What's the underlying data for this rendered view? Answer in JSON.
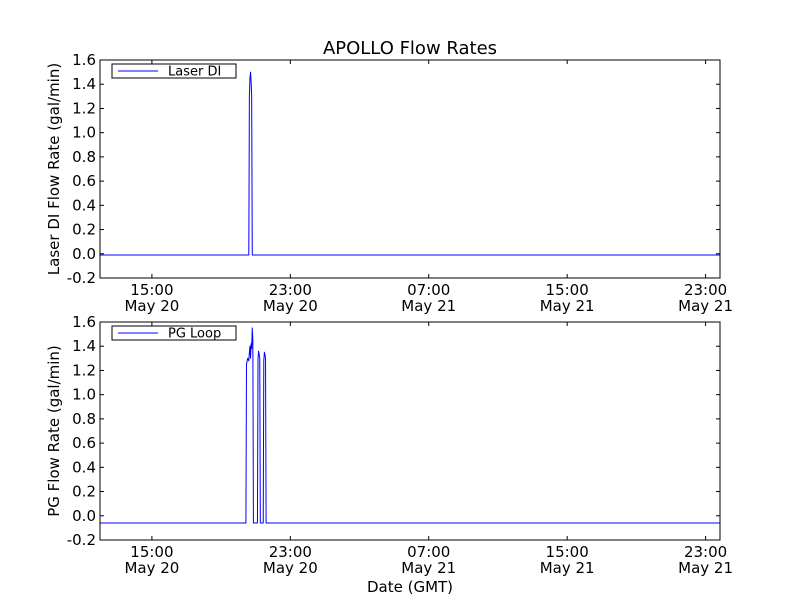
{
  "figure": {
    "title": "APOLLO Flow Rates",
    "xlabel": "Date (GMT)"
  },
  "chart_data": [
    {
      "type": "line",
      "ylabel": "Laser DI Flow Rate (gal/min)",
      "ylim": [
        -0.2,
        1.6
      ],
      "yticks": [
        -0.2,
        0.0,
        0.2,
        0.4,
        0.6,
        0.8,
        1.0,
        1.2,
        1.4,
        1.6
      ],
      "ytick_labels": [
        "-0.2",
        "0.0",
        "0.2",
        "0.4",
        "0.6",
        "0.8",
        "1.0",
        "1.2",
        "1.4",
        "1.6"
      ],
      "xlim": [
        "May 20 12:00",
        "May 21 23:50"
      ],
      "xticks": [
        {
          "time": "15:00",
          "date": "May 20"
        },
        {
          "time": "23:00",
          "date": "May 20"
        },
        {
          "time": "07:00",
          "date": "May 21"
        },
        {
          "time": "15:00",
          "date": "May 21"
        },
        {
          "time": "23:00",
          "date": "May 21"
        }
      ],
      "grid": false,
      "legend_loc": "upper-left",
      "series": [
        {
          "name": "Laser DI",
          "color": "#0000ff",
          "x": [
            "May 20 12:00",
            "May 20 20:30",
            "May 20 20:36",
            "May 20 20:38",
            "May 20 20:40",
            "May 20 20:42",
            "May 20 20:44",
            "May 20 20:46",
            "May 20 20:48",
            "May 20 20:54",
            "May 21 23:50"
          ],
          "y": [
            -0.01,
            -0.01,
            -0.01,
            1.3,
            1.45,
            1.5,
            1.42,
            1.3,
            -0.01,
            -0.01,
            -0.01
          ]
        }
      ]
    },
    {
      "type": "line",
      "ylabel": "PG Flow Rate (gal/min)",
      "ylim": [
        -0.2,
        1.6
      ],
      "yticks": [
        -0.2,
        0.0,
        0.2,
        0.4,
        0.6,
        0.8,
        1.0,
        1.2,
        1.4,
        1.6
      ],
      "ytick_labels": [
        "-0.2",
        "0.0",
        "0.2",
        "0.4",
        "0.6",
        "0.8",
        "1.0",
        "1.2",
        "1.4",
        "1.6"
      ],
      "xlim": [
        "May 20 12:00",
        "May 21 23:50"
      ],
      "xticks": [
        {
          "time": "15:00",
          "date": "May 20"
        },
        {
          "time": "23:00",
          "date": "May 20"
        },
        {
          "time": "07:00",
          "date": "May 21"
        },
        {
          "time": "15:00",
          "date": "May 21"
        },
        {
          "time": "23:00",
          "date": "May 21"
        }
      ],
      "grid": false,
      "legend_loc": "upper-left",
      "series": [
        {
          "name": "PG Loop",
          "color": "#0000ff",
          "x": [
            "May 20 12:00",
            "May 20 20:24",
            "May 20 20:26",
            "May 20 20:28",
            "May 20 20:32",
            "May 20 20:36",
            "May 20 20:38",
            "May 20 20:40",
            "May 20 20:42",
            "May 20 20:44",
            "May 20 20:46",
            "May 20 20:48",
            "May 20 20:50",
            "May 20 20:52",
            "May 20 20:54",
            "May 20 20:56",
            "May 20 20:58",
            "May 20 21:00",
            "May 20 21:06",
            "May 20 21:08",
            "May 20 21:10",
            "May 20 21:12",
            "May 20 21:14",
            "May 20 21:16",
            "May 20 21:18",
            "May 20 21:22",
            "May 20 21:26",
            "May 20 21:28",
            "May 20 21:30",
            "May 20 21:32",
            "May 20 21:34",
            "May 20 21:36",
            "May 20 21:38",
            "May 20 21:44",
            "May 21 23:50"
          ],
          "y": [
            -0.06,
            -0.06,
            -0.06,
            1.25,
            1.3,
            1.28,
            1.35,
            1.4,
            1.3,
            1.42,
            1.38,
            1.55,
            1.45,
            -0.06,
            -0.06,
            -0.06,
            -0.06,
            -0.06,
            -0.06,
            1.3,
            1.36,
            1.33,
            1.3,
            -0.06,
            -0.06,
            -0.06,
            -0.06,
            1.28,
            1.35,
            1.33,
            1.3,
            -0.06,
            -0.06,
            -0.06,
            -0.06
          ]
        }
      ]
    }
  ]
}
